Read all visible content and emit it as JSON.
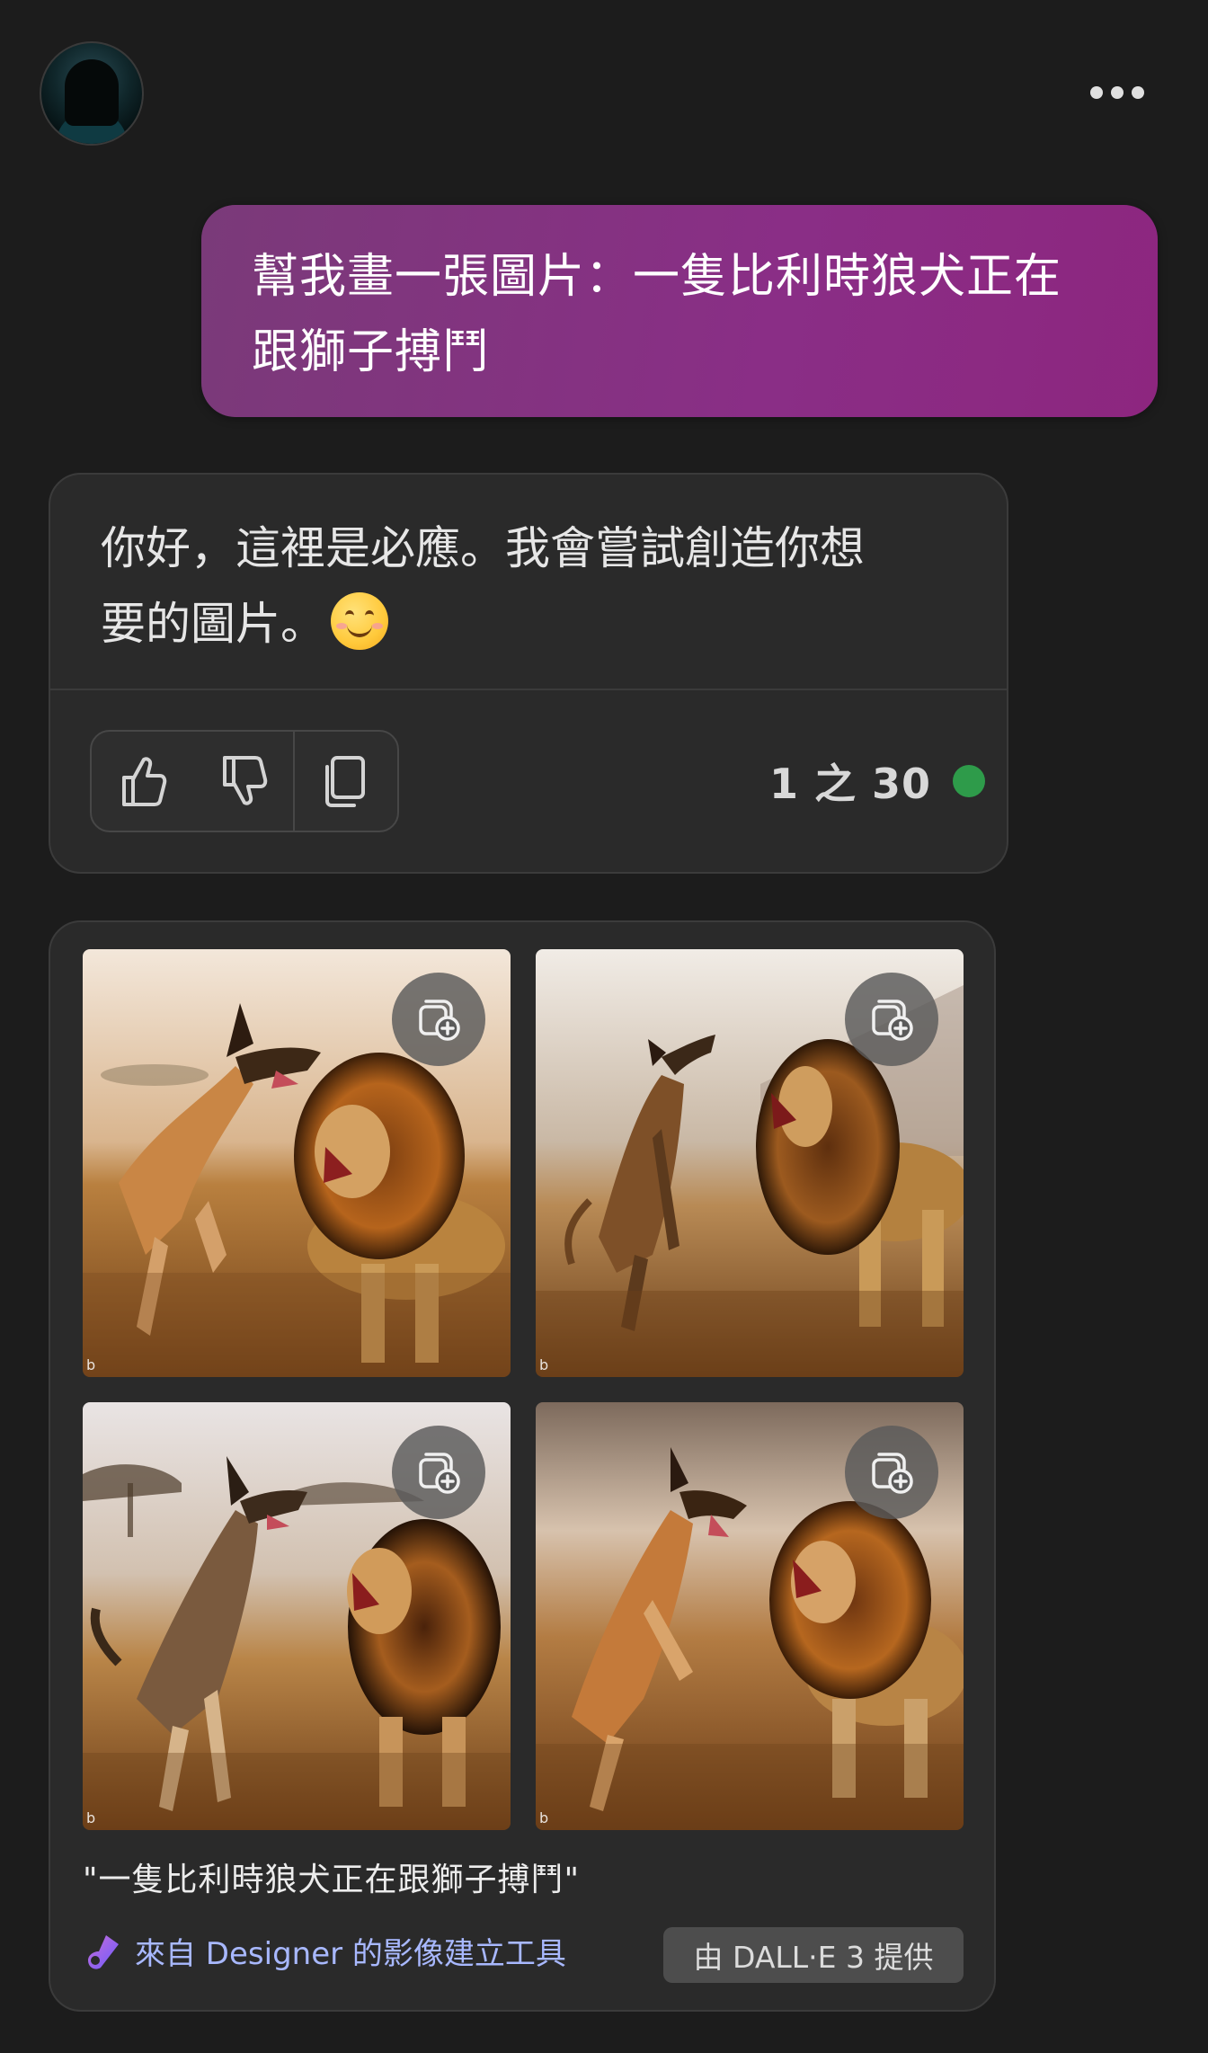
{
  "header": {
    "avatar_alt": "",
    "more_icon": "more-horizontal-icon"
  },
  "user_message": {
    "line1": "幫我畫一張圖片：一隻比利時狼犬正在",
    "line2": "跟獅子搏鬥"
  },
  "bot_message": {
    "line1": "你好，這裡是必應。我會嘗試創造你想",
    "line2": "要的圖片。",
    "emoji": "smiling-face-emoji",
    "like_icon": "thumbs-up-icon",
    "dislike_icon": "thumbs-down-icon",
    "copy_icon": "copy-icon",
    "counter": "1 之 30",
    "status_color": "#2e9b4a"
  },
  "image_result": {
    "caption": "\"一隻比利時狼犬正在跟獅子搏鬥\"",
    "designer_link": "來自 Designer 的影像建立工具",
    "provider": "由 DALL·E 3 提供",
    "add_icon": "add-to-collection-icon"
  },
  "colors": {
    "background": "#1c1c1c",
    "user_bubble": "#8a2e86",
    "card": "#2a2a2a",
    "link": "#a8b8ff"
  }
}
